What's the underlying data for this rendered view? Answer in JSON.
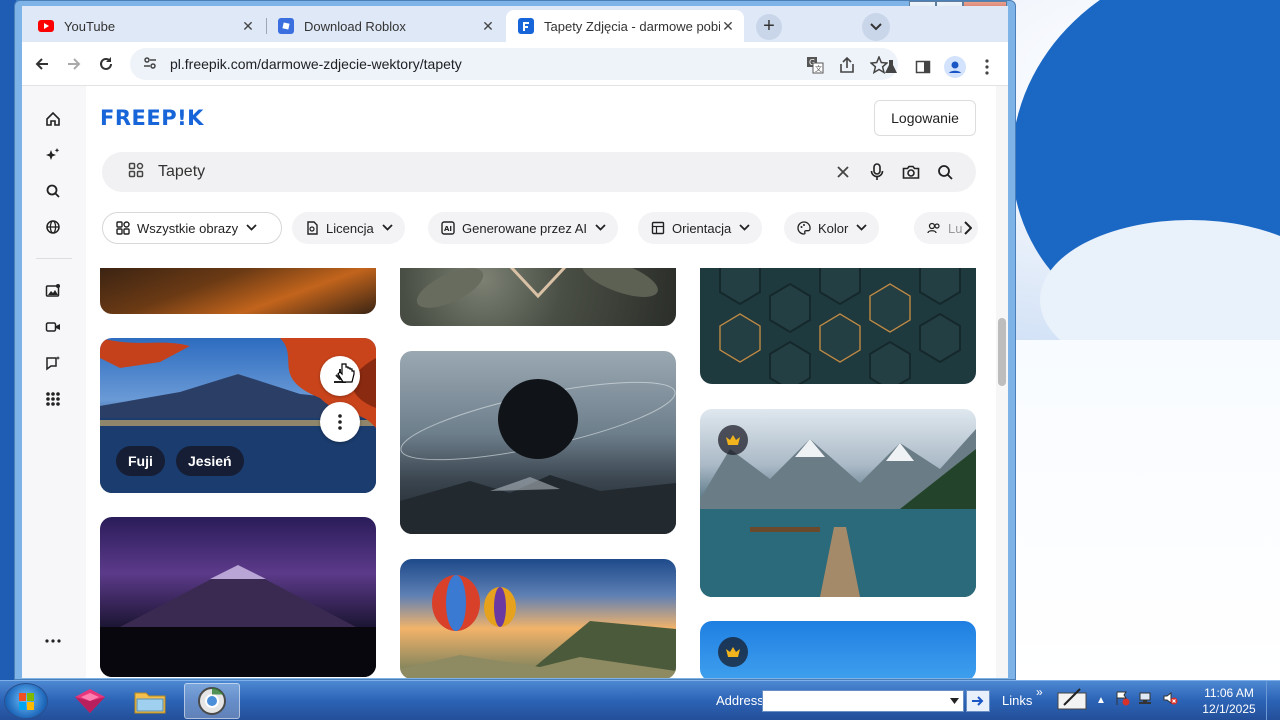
{
  "browser": {
    "tabs": [
      {
        "title": "YouTube",
        "favicon": "youtube-icon",
        "color": "#ff0000"
      },
      {
        "title": "Download Roblox",
        "favicon": "roblox-icon",
        "color": "#3b6fe0"
      },
      {
        "title": "Tapety Zdjęcia - darmowe pobie",
        "favicon": "freepik-icon",
        "color": "#1765d8",
        "active": true
      }
    ],
    "url": "pl.freepik.com/darmowe-zdjecie-wektory/tapety"
  },
  "site": {
    "logo": "FREEP!K",
    "login_label": "Logowanie",
    "search": {
      "query": "Tapety"
    },
    "filters": [
      {
        "label": "Wszystkie obrazy",
        "icon": "grid-icon"
      },
      {
        "label": "Licencja",
        "icon": "license-icon"
      },
      {
        "label": "Generowane przez AI",
        "icon": "ai-icon"
      },
      {
        "label": "Orientacja",
        "icon": "orientation-icon"
      },
      {
        "label": "Kolor",
        "icon": "palette-icon"
      },
      {
        "label": "Lu",
        "icon": "people-icon"
      }
    ],
    "image_tags": [
      "Fuji",
      "Jesień"
    ]
  },
  "taskbar": {
    "address_label": "Address",
    "links_label": "Links",
    "time": "11:06 AM",
    "date": "12/1/2025"
  }
}
